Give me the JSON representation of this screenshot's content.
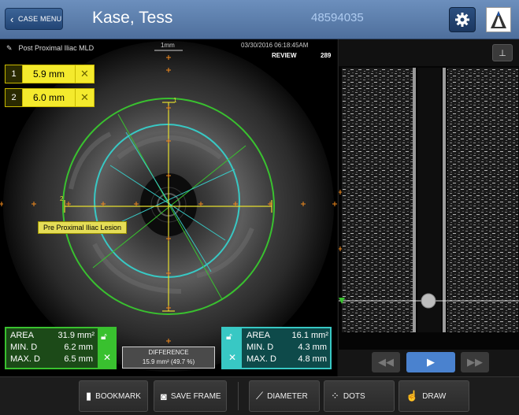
{
  "header": {
    "back_label": "CASE MENU",
    "patient_name": "Kase, Tess",
    "patient_id": "48594035"
  },
  "ivus": {
    "frame_label": "Post Proximal Iliac MLD",
    "scale_label": "1mm",
    "timestamp": "03/30/2016    06:18:45AM",
    "mode": "REVIEW",
    "frame_number": "289",
    "lesion_label": "Pre Proximal Iliac Lesion",
    "measurements": [
      {
        "index": "1",
        "value": "5.9 mm"
      },
      {
        "index": "2",
        "value": "6.0 mm"
      }
    ]
  },
  "stats_left": {
    "area_label": "AREA",
    "area_value": "31.9 mm²",
    "min_label": "MIN. D",
    "min_value": "6.2 mm",
    "max_label": "MAX. D",
    "max_value": "6.5 mm",
    "color": "#39c12f"
  },
  "stats_right": {
    "area_label": "AREA",
    "area_value": "16.1 mm²",
    "min_label": "MIN. D",
    "min_value": "4.3 mm",
    "max_label": "MAX. D",
    "max_value": "4.8 mm",
    "color": "#38c8c4"
  },
  "difference": {
    "label": "DIFFERENCE",
    "value": "15.9 mm² (49.7 %)"
  },
  "toolbar": {
    "bookmark": "BOOKMARK",
    "save_frame": "SAVE FRAME",
    "diameter": "DIAMETER",
    "dots": "DOTS",
    "draw": "DRAW"
  },
  "icons": {
    "back": "chevron-left-icon",
    "settings": "gear-icon",
    "logo": "brand-logo",
    "bookmark": "bookmark-icon",
    "save_frame": "camera-icon",
    "diameter": "diameter-icon",
    "dots": "dots-icon",
    "draw": "draw-hand-icon"
  }
}
